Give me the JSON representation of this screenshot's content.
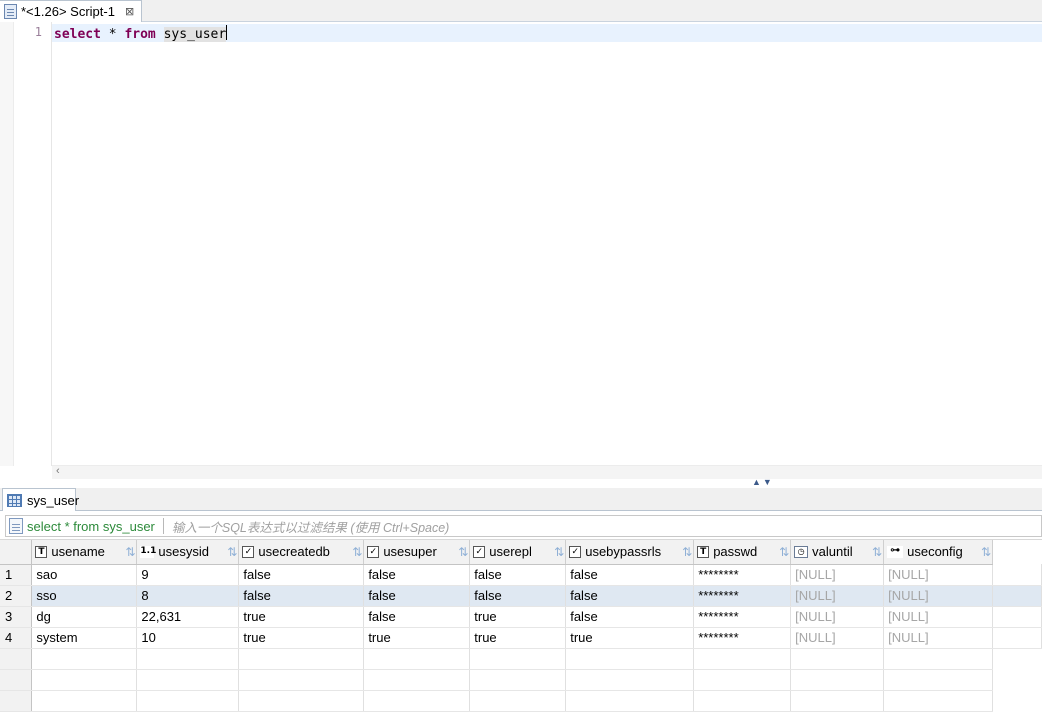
{
  "editor_tab": {
    "title": "*<1.26> Script-1",
    "close_glyph": "⊠"
  },
  "editor": {
    "line_number": "1",
    "tokens": {
      "select": "select",
      "star": " * ",
      "from": "from",
      "space": " ",
      "table": "sys_user"
    }
  },
  "results_tab": {
    "label": "sys_user"
  },
  "filter": {
    "query": "select * from sys_user",
    "placeholder": "输入一个SQL表达式以过滤结果 (使用 Ctrl+Space)"
  },
  "columns": [
    {
      "name": "usename",
      "type_icon": "text-type-icon",
      "glyph": "T"
    },
    {
      "name": "usesysid",
      "type_icon": "number-type-icon",
      "glyph": "1.1"
    },
    {
      "name": "usecreatedb",
      "type_icon": "boolean-type-icon",
      "glyph": "✓"
    },
    {
      "name": "usesuper",
      "type_icon": "boolean-type-icon",
      "glyph": "✓"
    },
    {
      "name": "userepl",
      "type_icon": "boolean-type-icon",
      "glyph": "✓"
    },
    {
      "name": "usebypassrls",
      "type_icon": "boolean-type-icon",
      "glyph": "✓"
    },
    {
      "name": "passwd",
      "type_icon": "text-type-icon",
      "glyph": "T"
    },
    {
      "name": "valuntil",
      "type_icon": "datetime-type-icon",
      "glyph": "◷"
    },
    {
      "name": "useconfig",
      "type_icon": "array-type-icon",
      "glyph": "⊶"
    }
  ],
  "sort_glyph": "⇅",
  "rows": [
    {
      "n": "1",
      "cells": [
        "sao",
        "9",
        "false",
        "false",
        "false",
        "false",
        "********",
        "[NULL]",
        "[NULL]"
      ]
    },
    {
      "n": "2",
      "cells": [
        "sso",
        "8",
        "false",
        "false",
        "false",
        "false",
        "********",
        "[NULL]",
        "[NULL]"
      ]
    },
    {
      "n": "3",
      "cells": [
        "dg",
        "22,631",
        "true",
        "false",
        "true",
        "false",
        "********",
        "[NULL]",
        "[NULL]"
      ]
    },
    {
      "n": "4",
      "cells": [
        "system",
        "10",
        "true",
        "true",
        "true",
        "true",
        "********",
        "[NULL]",
        "[NULL]"
      ]
    }
  ]
}
